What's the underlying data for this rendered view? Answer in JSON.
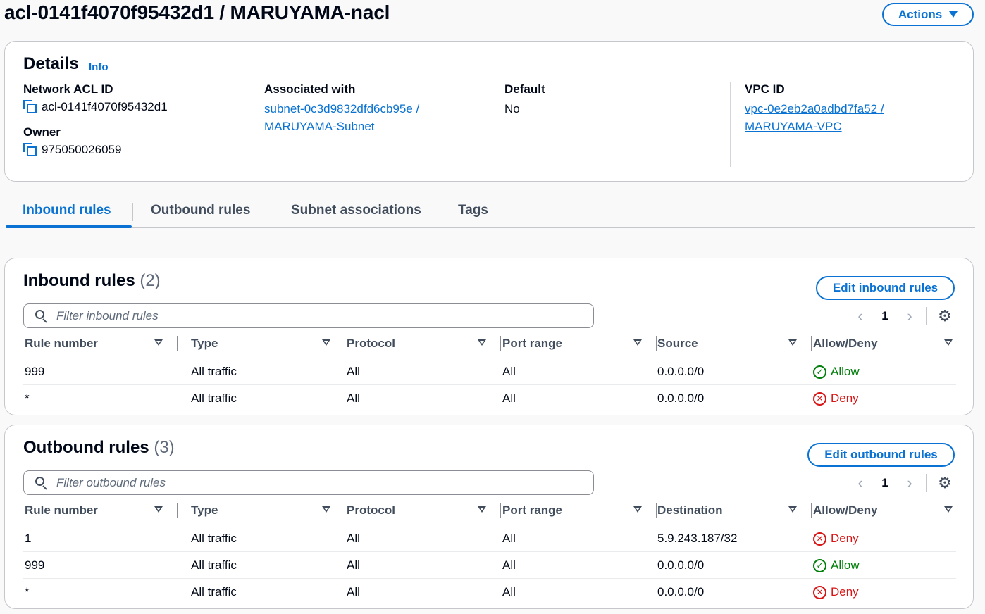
{
  "header": {
    "title": "acl-0141f4070f95432d1 / MARUYAMA-nacl",
    "actions_label": "Actions"
  },
  "details": {
    "title": "Details",
    "info_label": "Info",
    "network_acl_id_label": "Network ACL ID",
    "network_acl_id": "acl-0141f4070f95432d1",
    "owner_label": "Owner",
    "owner": "975050026059",
    "associated_with_label": "Associated with",
    "associated_line1": "subnet-0c3d9832dfd6cb95e /",
    "associated_line2": "MARUYAMA-Subnet",
    "default_label": "Default",
    "default_value": "No",
    "vpc_id_label": "VPC ID",
    "vpc_line1": "vpc-0e2eb2a0adbd7fa52 /",
    "vpc_line2": "MARUYAMA-VPC"
  },
  "tabs": [
    "Inbound rules",
    "Outbound rules",
    "Subnet associations",
    "Tags"
  ],
  "inbound": {
    "title": "Inbound rules",
    "count": "(2)",
    "edit_label": "Edit inbound rules",
    "filter_placeholder": "Filter inbound rules",
    "page": "1",
    "columns": [
      "Rule number",
      "Type",
      "Protocol",
      "Port range",
      "Source",
      "Allow/Deny"
    ],
    "rows": [
      {
        "rule": "999",
        "type": "All traffic",
        "protocol": "All",
        "port": "All",
        "addr": "0.0.0.0/0",
        "action": "Allow"
      },
      {
        "rule": "*",
        "type": "All traffic",
        "protocol": "All",
        "port": "All",
        "addr": "0.0.0.0/0",
        "action": "Deny"
      }
    ]
  },
  "outbound": {
    "title": "Outbound rules",
    "count": "(3)",
    "edit_label": "Edit outbound rules",
    "filter_placeholder": "Filter outbound rules",
    "page": "1",
    "columns": [
      "Rule number",
      "Type",
      "Protocol",
      "Port range",
      "Destination",
      "Allow/Deny"
    ],
    "rows": [
      {
        "rule": "1",
        "type": "All traffic",
        "protocol": "All",
        "port": "All",
        "addr": "5.9.243.187/32",
        "action": "Deny"
      },
      {
        "rule": "999",
        "type": "All traffic",
        "protocol": "All",
        "port": "All",
        "addr": "0.0.0.0/0",
        "action": "Allow"
      },
      {
        "rule": "*",
        "type": "All traffic",
        "protocol": "All",
        "port": "All",
        "addr": "0.0.0.0/0",
        "action": "Deny"
      }
    ]
  },
  "colors": {
    "accent": "#0972d3",
    "allow": "#037f0c",
    "deny": "#d91515"
  },
  "icons": {
    "copy": "copy-icon",
    "search": "search-icon",
    "settings": "gear-icon",
    "allow": "check-circle-icon",
    "deny": "x-circle-icon"
  }
}
